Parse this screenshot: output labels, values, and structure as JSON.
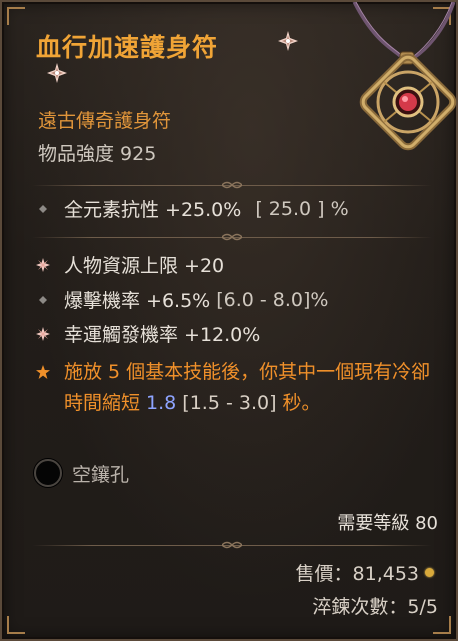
{
  "item": {
    "name": "血行加速護身符",
    "type": "遠古傳奇護身符",
    "item_power": "物品強度 925"
  },
  "implicit": {
    "text": "全元素抗性 +25.0%",
    "range": "[ 25.0 ] %"
  },
  "affixes": [
    {
      "text": "人物資源上限 +20",
      "range": "",
      "bullet": "greater"
    },
    {
      "text": "爆擊機率 +6.5%",
      "range": "[6.0 - 8.0]%",
      "bullet": "diamond"
    },
    {
      "text": "幸運觸發機率 +12.0%",
      "range": "",
      "bullet": "greater"
    }
  ],
  "legendary": {
    "text_before": "施放 5 個基本技能後，你其中一個現有冷卻時間縮短 ",
    "value": "1.8",
    "range": " [1.5 - 3.0]",
    "text_after": " 秒。"
  },
  "socket": {
    "label": "空鑲孔"
  },
  "requirements": {
    "level": "需要等級 80"
  },
  "sell": {
    "label": "售價：81,453"
  },
  "temper": {
    "label": "淬鍊次數：5/5"
  },
  "colors": {
    "title": "#f0a436",
    "legendary": "#f0902a",
    "value_highlight": "#8ea4ff"
  },
  "icons": {
    "greater_affix": "star-burst-icon",
    "regular_affix": "diamond-icon",
    "legendary_affix": "star-icon",
    "socket": "empty-socket-icon",
    "currency": "gold-coin-icon"
  }
}
